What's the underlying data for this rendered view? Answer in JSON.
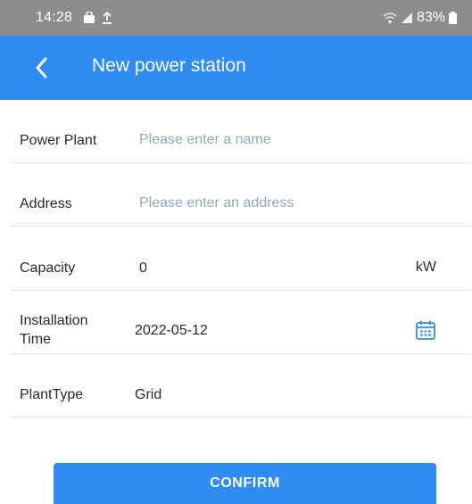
{
  "status_bar": {
    "time": "14:28",
    "battery": "83%",
    "icons": [
      "bag-icon",
      "upload-icon",
      "wifi-icon",
      "signal-icon",
      "battery-icon"
    ]
  },
  "header": {
    "back_icon": "chevron-left-icon",
    "title": "New power station"
  },
  "form": {
    "power_plant": {
      "label": "Power Plant",
      "placeholder": "Please enter a name",
      "value": ""
    },
    "address": {
      "label": "Address",
      "placeholder": "Please enter an address",
      "value": ""
    },
    "capacity": {
      "label": "Capacity",
      "value": "0",
      "unit": "kW"
    },
    "installation_time": {
      "label_line1": "Installation",
      "label_line2": "Time",
      "value": "2022-05-12",
      "icon": "calendar-icon"
    },
    "plant_type": {
      "label": "PlantType",
      "value": "Grid"
    }
  },
  "confirm_label": "CONFIRM",
  "colors": {
    "accent": "#2f8cf0",
    "status_bar": "#8d8d8d",
    "placeholder": "#8fa8bf",
    "divider": "#e4e4e4"
  }
}
